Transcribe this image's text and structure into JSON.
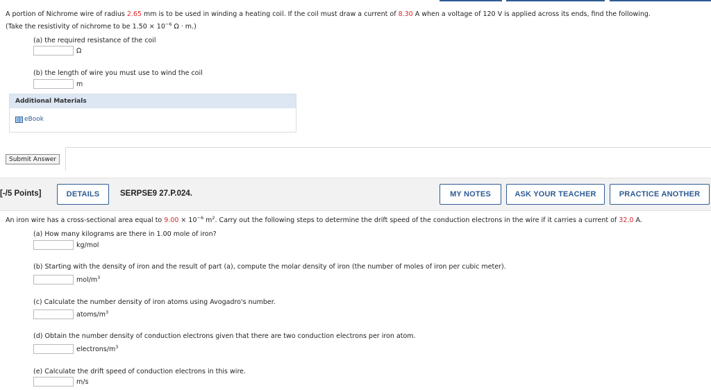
{
  "problem1": {
    "intro_a": "A portion of Nichrome wire of radius ",
    "radius": "2.65",
    "intro_b": " mm is to be used in winding a heating coil. If the coil must draw a current of ",
    "current": "8.30",
    "intro_c": " A when a voltage of 120 V is applied across its ends, find the following.",
    "note_a": "(Take the resistivity of nichrome to be 1.50 × 10",
    "note_exp": "−6",
    "note_b": " Ω · m.)",
    "part_a": "(a) the required resistance of the coil",
    "part_a_unit": "Ω",
    "part_b": "(b) the length of wire you must use to wind the coil",
    "part_b_unit": "m",
    "materials_header": "Additional Materials",
    "ebook_label": "eBook",
    "submit_label": "Submit Answer"
  },
  "problem2_header": {
    "points": "[-/5 Points]",
    "details_label": "DETAILS",
    "problem_id": "SERPSE9 27.P.024.",
    "my_notes_label": "MY NOTES",
    "ask_teacher_label": "ASK YOUR TEACHER",
    "practice_label": "PRACTICE ANOTHER"
  },
  "problem2": {
    "intro_a": "An iron wire has a cross-sectional area equal to ",
    "area": "9.00",
    "intro_b": " × 10",
    "area_exp": "−6",
    "intro_c": " m",
    "area_unit_exp": "2",
    "intro_d": ". Carry out the following steps to determine the drift speed of the conduction electrons in the wire if it carries a current of ",
    "current": "32.0",
    "intro_e": " A.",
    "part_a": "(a) How many kilograms are there in 1.00 mole of iron?",
    "part_a_unit": "kg/mol",
    "part_b": "(b) Starting with the density of iron and the result of part (a), compute the molar density of iron (the number of moles of iron per cubic meter).",
    "part_b_unit": "mol/m",
    "part_c": "(c) Calculate the number density of iron atoms using Avogadro's number.",
    "part_c_unit": "atoms/m",
    "part_d": "(d) Obtain the number density of conduction electrons given that there are two conduction electrons per iron atom.",
    "part_d_unit": "electrons/m",
    "part_e": "(e) Calculate the drift speed of conduction electrons in this wire.",
    "part_e_unit": "m/s",
    "cube_exp": "3"
  },
  "colors": {
    "accent_blue": "#2e5b93",
    "value_red": "#d9262b",
    "materials_bg": "#dde6f3"
  }
}
